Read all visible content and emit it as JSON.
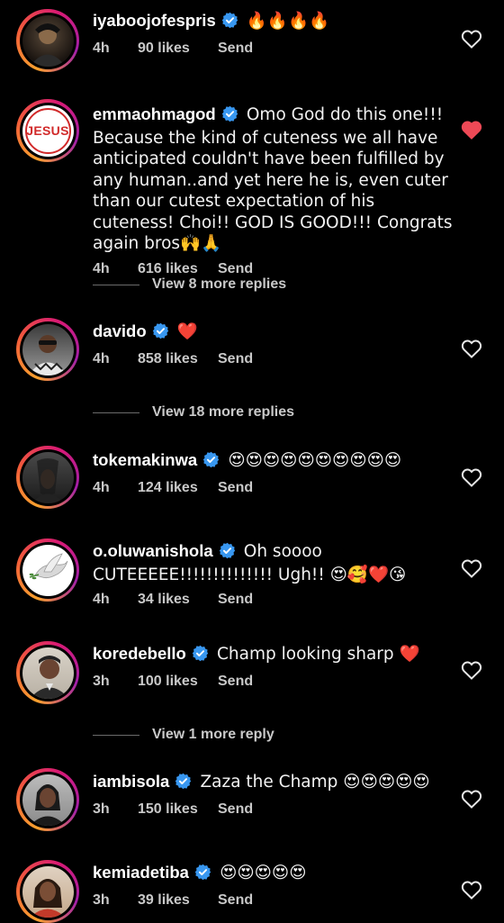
{
  "colors": {
    "background": "#000000",
    "verified": "#3897f0",
    "liked_heart": "#ed4956",
    "meta_text": "#c9c9c9"
  },
  "comments": [
    {
      "username": "iyaboojofespris",
      "verified": true,
      "text": "🔥🔥🔥🔥",
      "time": "4h",
      "likes": "90 likes",
      "send": "Send",
      "liked": false
    },
    {
      "username": "emmaohmagod",
      "verified": true,
      "avatar_text": "JESUS",
      "text": "Omo God do this one!!! Because the kind of cuteness we all have anticipated couldn't have been fulfilled by any human..and yet here he is, even cuter than our cutest expectation of his cuteness! Choi!! GOD IS GOOD!!! Congrats again bros🙌🙏",
      "time": "4h",
      "likes": "616 likes",
      "send": "Send",
      "liked": true
    },
    {
      "username": "davido",
      "verified": true,
      "text": "❤️",
      "time": "4h",
      "likes": "858 likes",
      "send": "Send",
      "liked": false
    },
    {
      "username": "tokemakinwa",
      "verified": true,
      "text": "😍😍😍😍😍😍😍😍😍😍",
      "time": "4h",
      "likes": "124 likes",
      "send": "Send",
      "liked": false
    },
    {
      "username": "o.oluwanishola",
      "verified": true,
      "text": "Oh soooo CUTEEEEE!!!!!!!!!!!!!! Ugh!! 😍🥰❤️😘",
      "time": "4h",
      "likes": "34 likes",
      "send": "Send",
      "liked": false
    },
    {
      "username": "koredebello",
      "verified": true,
      "text": "Champ looking sharp ❤️",
      "time": "3h",
      "likes": "100 likes",
      "send": "Send",
      "liked": false
    },
    {
      "username": "iambisola",
      "verified": true,
      "text": "Zaza the Champ 😍😍😍😍😍",
      "time": "3h",
      "likes": "150 likes",
      "send": "Send",
      "liked": false
    },
    {
      "username": "kemiadetiba",
      "verified": true,
      "text": "😍😍😍😍😍",
      "time": "3h",
      "likes": "39 likes",
      "send": "Send",
      "liked": false
    }
  ],
  "view_replies": [
    {
      "label": "View 8 more replies"
    },
    {
      "label": "View 18 more replies"
    },
    {
      "label": "View 1 more reply"
    }
  ]
}
